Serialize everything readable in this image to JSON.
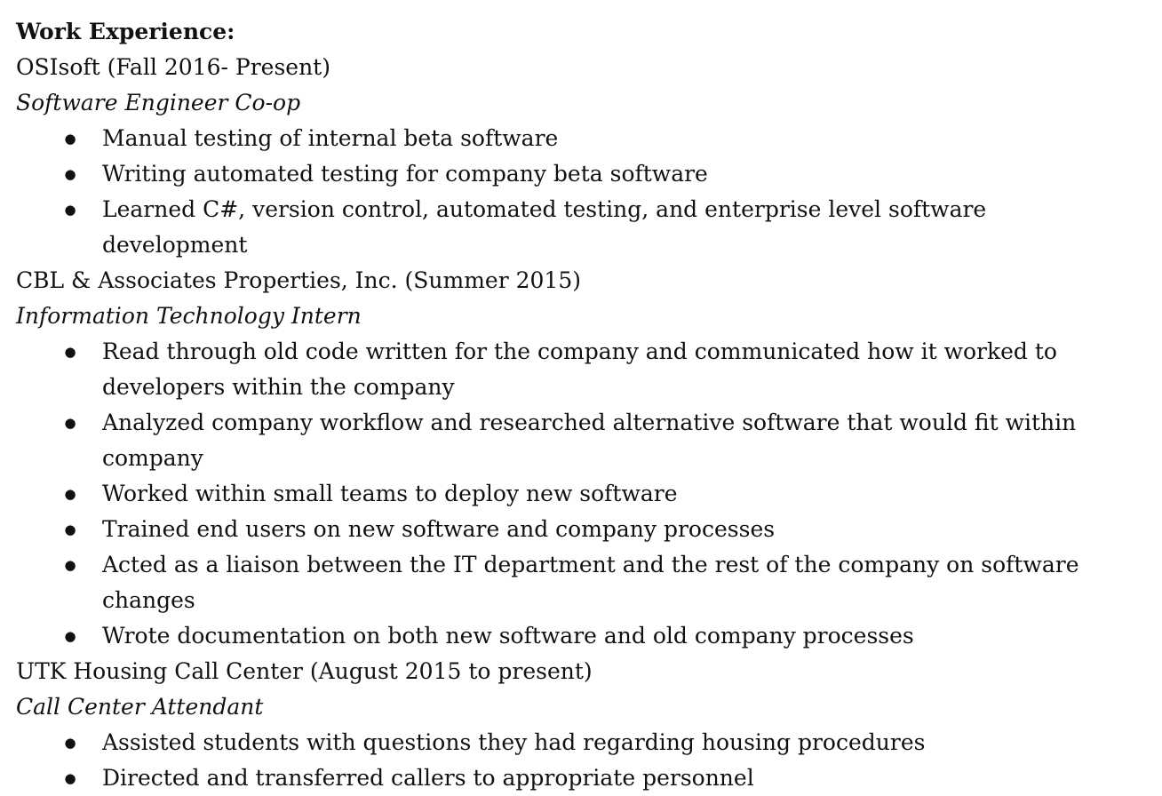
{
  "heading": "Work Experience:",
  "bullet_glyph": "●",
  "jobs": [
    {
      "company": "OSIsoft (Fall 2016- Present)",
      "role": "Software Engineer Co-op",
      "bullets": [
        "Manual testing of internal beta software",
        "Writing automated testing for company beta software",
        "Learned C#, version control, automated testing, and enterprise level software development"
      ]
    },
    {
      "company": "CBL & Associates Properties, Inc. (Summer 2015)",
      "role": "Information Technology Intern",
      "bullets": [
        "Read through old code written for the company and communicated how it worked to developers within the company",
        "Analyzed company workflow and researched alternative software that would fit within company",
        "Worked within small teams to deploy new software",
        "Trained end users on new software and company processes",
        "Acted as a liaison between the IT department and the rest of the company on software changes",
        "Wrote documentation on both new software and old company processes"
      ]
    },
    {
      "company": "UTK Housing Call Center (August 2015 to present)",
      "role": "Call Center Attendant",
      "bullets": [
        "Assisted students with questions they had regarding housing procedures",
        "Directed and transferred callers to appropriate personnel"
      ]
    }
  ]
}
